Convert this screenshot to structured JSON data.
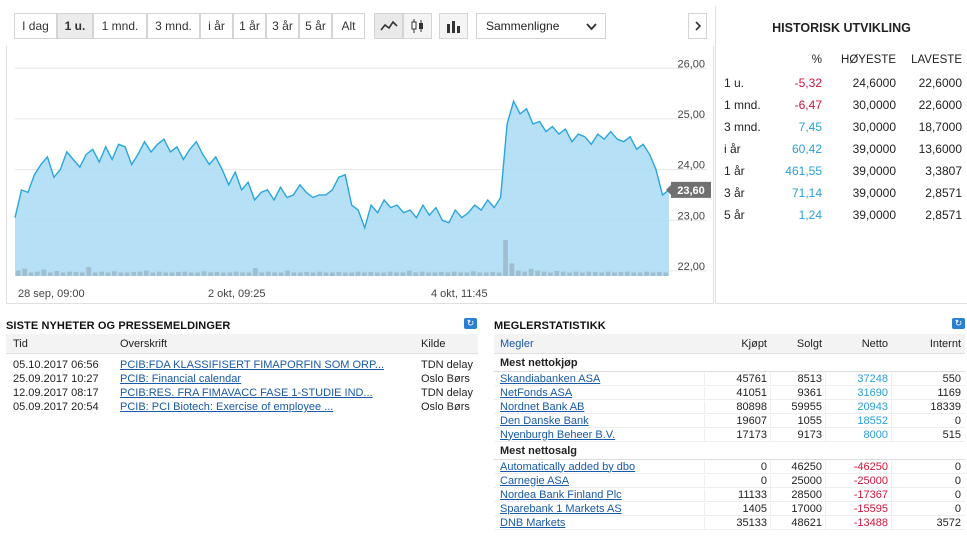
{
  "toolbar": {
    "ranges": [
      "I dag",
      "1 u.",
      "1 mnd.",
      "3 mnd.",
      "i år",
      "1 år",
      "3 år",
      "5 år",
      "Alt"
    ],
    "active_range": "1 u.",
    "compare_label": "Sammenligne",
    "tools": [
      "line-chart-icon",
      "candlestick-icon",
      "volume-icon"
    ]
  },
  "chart_data": {
    "type": "area",
    "y_ticks": [
      "26,00",
      "25,00",
      "24,00",
      "23,00",
      "22,00"
    ],
    "ylim": [
      21.9,
      26.4
    ],
    "x_labels": [
      "28 sep, 09:00",
      "2 okt, 09:25",
      "4 okt, 11:45"
    ],
    "last_value_label": "23,60",
    "prices": [
      23.05,
      23.6,
      23.55,
      23.9,
      24.1,
      24.25,
      23.85,
      24.0,
      24.35,
      24.2,
      24.05,
      24.3,
      24.4,
      24.15,
      24.45,
      24.2,
      24.5,
      24.45,
      24.1,
      24.3,
      24.55,
      24.35,
      24.5,
      24.6,
      24.35,
      24.45,
      24.2,
      24.4,
      24.55,
      24.3,
      24.1,
      24.25,
      24.0,
      23.7,
      23.95,
      23.6,
      23.75,
      23.4,
      23.55,
      23.6,
      23.4,
      23.65,
      23.45,
      23.5,
      23.7,
      23.55,
      23.45,
      23.5,
      23.5,
      23.6,
      23.85,
      23.9,
      23.3,
      23.2,
      22.85,
      23.3,
      23.15,
      23.4,
      23.25,
      23.3,
      23.15,
      23.2,
      23.05,
      23.3,
      23.1,
      23.25,
      23.0,
      22.95,
      23.2,
      23.05,
      23.15,
      23.3,
      23.2,
      23.4,
      23.25,
      23.45,
      24.9,
      25.35,
      25.1,
      25.2,
      24.9,
      24.95,
      24.75,
      24.85,
      24.7,
      24.8,
      24.55,
      24.7,
      24.65,
      24.5,
      24.7,
      24.6,
      24.75,
      24.6,
      24.55,
      24.65,
      24.4,
      24.5,
      24.3,
      24.0,
      23.5,
      23.6
    ],
    "volumes": [
      0.15,
      0.2,
      0.1,
      0.12,
      0.18,
      0.1,
      0.14,
      0.1,
      0.12,
      0.11,
      0.1,
      0.25,
      0.1,
      0.12,
      0.1,
      0.13,
      0.1,
      0.1,
      0.11,
      0.12,
      0.15,
      0.1,
      0.12,
      0.1,
      0.1,
      0.11,
      0.12,
      0.1,
      0.1,
      0.13,
      0.1,
      0.11,
      0.1,
      0.1,
      0.12,
      0.1,
      0.1,
      0.22,
      0.1,
      0.12,
      0.1,
      0.1,
      0.15,
      0.1,
      0.1,
      0.11,
      0.1,
      0.12,
      0.1,
      0.1,
      0.11,
      0.1,
      0.1,
      0.12,
      0.1,
      0.11,
      0.1,
      0.1,
      0.12,
      0.1,
      0.1,
      0.15,
      0.1,
      0.12,
      0.1,
      0.1,
      0.11,
      0.1,
      0.12,
      0.1,
      0.1,
      0.13,
      0.1,
      0.1,
      0.11,
      0.1,
      1.0,
      0.35,
      0.15,
      0.12,
      0.2,
      0.15,
      0.12,
      0.1,
      0.14,
      0.12,
      0.1,
      0.12,
      0.1,
      0.12,
      0.11,
      0.1,
      0.12,
      0.1,
      0.11,
      0.12,
      0.1,
      0.1,
      0.12,
      0.1,
      0.11,
      0.1
    ],
    "colors": {
      "line": "#2aa6dd",
      "fill": "#a9dbf3",
      "volume": "#9fbfd1",
      "label_bg": "#707070"
    }
  },
  "history": {
    "title": "HISTORISK UTVIKLING",
    "headers": [
      "",
      "%",
      "HØYESTE",
      "LAVESTE"
    ],
    "rows": [
      {
        "period": "1 u.",
        "pct": "-5,32",
        "high": "24,6000",
        "low": "22,6000",
        "neg": true
      },
      {
        "period": "1 mnd.",
        "pct": "-6,47",
        "high": "30,0000",
        "low": "22,6000",
        "neg": true
      },
      {
        "period": "3 mnd.",
        "pct": "7,45",
        "high": "30,0000",
        "low": "18,7000",
        "neg": false
      },
      {
        "period": "i år",
        "pct": "60,42",
        "high": "39,0000",
        "low": "13,6000",
        "neg": false
      },
      {
        "period": "1 år",
        "pct": "461,55",
        "high": "39,0000",
        "low": "3,3807",
        "neg": false
      },
      {
        "period": "3 år",
        "pct": "71,14",
        "high": "39,0000",
        "low": "2,8571",
        "neg": false
      },
      {
        "period": "5 år",
        "pct": "1,24",
        "high": "39,0000",
        "low": "2,8571",
        "neg": false
      }
    ]
  },
  "news": {
    "title": "SISTE NYHETER OG PRESSEMELDINGER",
    "headers": [
      "Tid",
      "Overskrift",
      "Kilde"
    ],
    "rows": [
      {
        "time": "05.10.2017 06:56",
        "headline": "PCIB:FDA KLASSIFISERT FIMAPORFIN SOM ORP...",
        "source": "TDN delay"
      },
      {
        "time": "25.09.2017 10:27",
        "headline": "PCIB: Financial calendar",
        "source": "Oslo Børs"
      },
      {
        "time": "12.09.2017 08:17",
        "headline": "PCIB:RES. FRA FIMAVACC FASE 1-STUDIE IND...",
        "source": "TDN delay"
      },
      {
        "time": "05.09.2017 20:54",
        "headline": "PCIB: PCI Biotech: Exercise of employee ...",
        "source": "Oslo Børs"
      }
    ]
  },
  "brokers": {
    "title": "MEGLERSTATISTIKK",
    "headers": [
      "Megler",
      "Kjøpt",
      "Solgt",
      "Netto",
      "Internt"
    ],
    "buy_title": "Mest nettokjøp",
    "sell_title": "Mest nettosalg",
    "buy": [
      {
        "name": "Skandiabanken ASA",
        "bought": "45761",
        "sold": "8513",
        "net": "37248",
        "internal": "550"
      },
      {
        "name": "NetFonds ASA",
        "bought": "41051",
        "sold": "9361",
        "net": "31690",
        "internal": "1169"
      },
      {
        "name": "Nordnet Bank AB",
        "bought": "80898",
        "sold": "59955",
        "net": "20943",
        "internal": "18339"
      },
      {
        "name": "Den Danske Bank",
        "bought": "19607",
        "sold": "1055",
        "net": "18552",
        "internal": "0"
      },
      {
        "name": "Nyenburgh Beheer B.V.",
        "bought": "17173",
        "sold": "9173",
        "net": "8000",
        "internal": "515"
      }
    ],
    "sell": [
      {
        "name": "Automatically added by dbo",
        "bought": "0",
        "sold": "46250",
        "net": "-46250",
        "internal": "0"
      },
      {
        "name": "Carnegie ASA",
        "bought": "0",
        "sold": "25000",
        "net": "-25000",
        "internal": "0"
      },
      {
        "name": "Nordea Bank Finland Plc",
        "bought": "11133",
        "sold": "28500",
        "net": "-17367",
        "internal": "0"
      },
      {
        "name": "Sparebank 1 Markets AS",
        "bought": "1405",
        "sold": "17000",
        "net": "-15595",
        "internal": "0"
      },
      {
        "name": "DNB Markets",
        "bought": "35133",
        "sold": "48621",
        "net": "-13488",
        "internal": "3572"
      }
    ]
  }
}
